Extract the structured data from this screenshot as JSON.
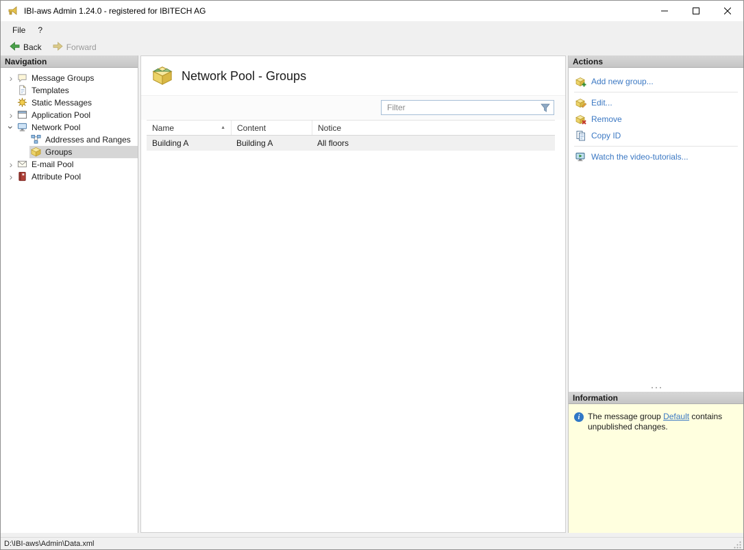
{
  "window": {
    "title": "IBI-aws Admin 1.24.0 - registered for IBITECH AG"
  },
  "menu": {
    "file": "File",
    "help": "?"
  },
  "toolbar": {
    "back": "Back",
    "forward": "Forward"
  },
  "navigation": {
    "header": "Navigation",
    "items": [
      {
        "label": "Message Groups",
        "expandable": true
      },
      {
        "label": "Templates"
      },
      {
        "label": "Static Messages"
      },
      {
        "label": "Application Pool",
        "expandable": true
      },
      {
        "label": "Network Pool",
        "expanded": true
      },
      {
        "label": "Addresses and Ranges",
        "child": true
      },
      {
        "label": "Groups",
        "child": true,
        "selected": true
      },
      {
        "label": "E-mail Pool",
        "expandable": true
      },
      {
        "label": "Attribute Pool",
        "expandable": true
      }
    ]
  },
  "main": {
    "title": "Network Pool - Groups",
    "filter": {
      "placeholder": "Filter"
    },
    "table": {
      "columns": [
        "Name",
        "Content",
        "Notice"
      ],
      "sorted_column": "Name",
      "sort_direction": "ascending",
      "rows": [
        [
          "Building A",
          "Building A",
          "All floors"
        ]
      ]
    }
  },
  "actions": {
    "header": "Actions",
    "items": [
      {
        "label": "Add new group..."
      },
      {
        "label": "Edit..."
      },
      {
        "label": "Remove"
      },
      {
        "label": "Copy ID"
      },
      {
        "label": "Watch the video-tutorials..."
      }
    ]
  },
  "information": {
    "header": "Information",
    "text_before": "The message group ",
    "link_label": "Default",
    "text_after": " contains unpublished changes."
  },
  "statusbar": {
    "path": "D:\\IBI-aws\\Admin\\Data.xml"
  },
  "colors": {
    "link": "#3b78c3",
    "info_background": "#ffffdf",
    "selection": "#d6d6d6"
  }
}
